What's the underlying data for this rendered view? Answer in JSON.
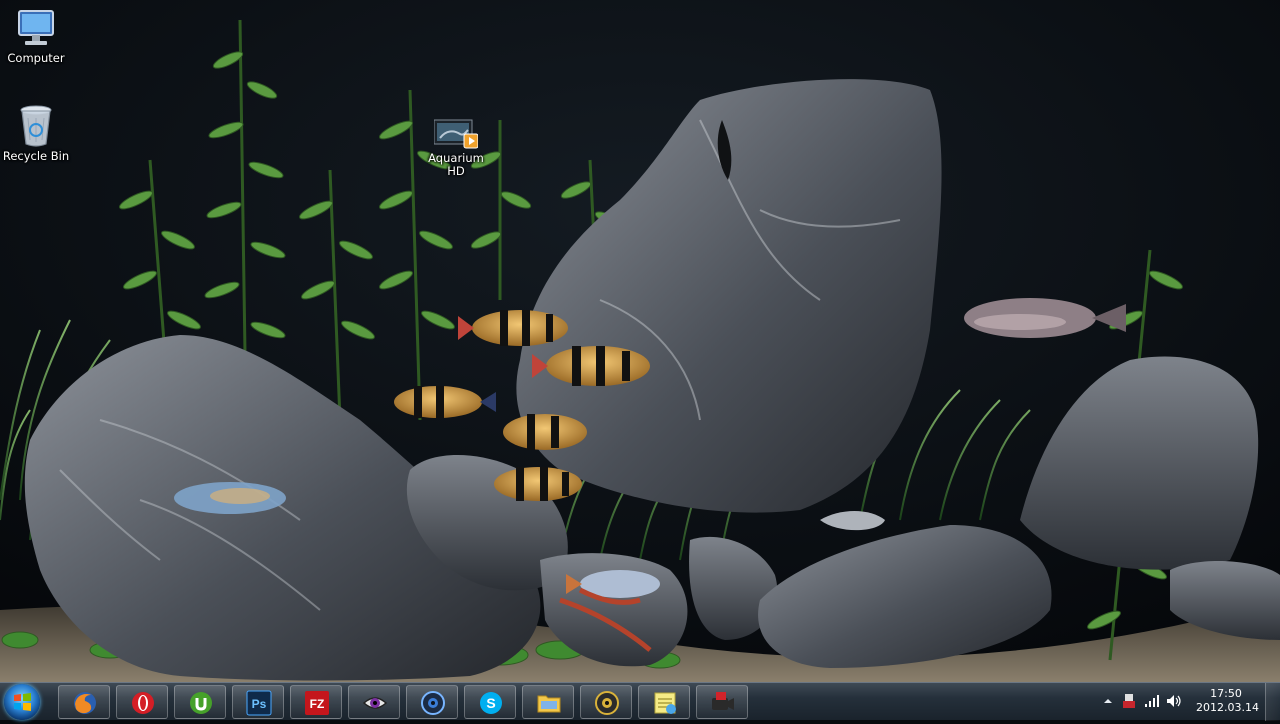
{
  "desktop": {
    "icons": [
      {
        "label": "Computer",
        "icon": "computer-icon"
      },
      {
        "label": "Recycle Bin",
        "icon": "recycle-bin-icon"
      },
      {
        "label": "Aquarium HD",
        "icon": "video-shortcut-icon"
      }
    ]
  },
  "taskbar": {
    "start_icon": "windows-start-orb",
    "pinned": [
      {
        "app": "Firefox",
        "icon": "firefox-icon"
      },
      {
        "app": "Opera",
        "icon": "opera-icon"
      },
      {
        "app": "uTorrent",
        "icon": "utorrent-icon"
      },
      {
        "app": "Photoshop",
        "icon": "photoshop-icon",
        "text": "Ps"
      },
      {
        "app": "FileZilla",
        "icon": "filezilla-icon",
        "text": "FZ"
      },
      {
        "app": "Eye app",
        "icon": "eye-icon"
      },
      {
        "app": "Media player",
        "icon": "media-disc-icon"
      },
      {
        "app": "Skype",
        "icon": "skype-icon",
        "text": "S"
      },
      {
        "app": "Explorer",
        "icon": "folder-icon"
      },
      {
        "app": "Webcam",
        "icon": "webcam-icon"
      },
      {
        "app": "Notes",
        "icon": "notes-icon"
      },
      {
        "app": "Video recorder",
        "icon": "video-camera-icon"
      }
    ],
    "tray": {
      "icons": [
        "show-hidden-icons-arrow",
        "usb-icon",
        "network-signal-icon",
        "volume-icon"
      ],
      "time": "17:50",
      "date": "2012.03.14"
    }
  },
  "colors": {
    "taskbar_top": "#3f4a55",
    "taskbar_bottom": "#1a232c",
    "water": "#070a0d",
    "rock": "#4b5058",
    "plant": "#4a8a3a",
    "fish_stripe": "#111111",
    "fish_body": "#c99a45"
  }
}
